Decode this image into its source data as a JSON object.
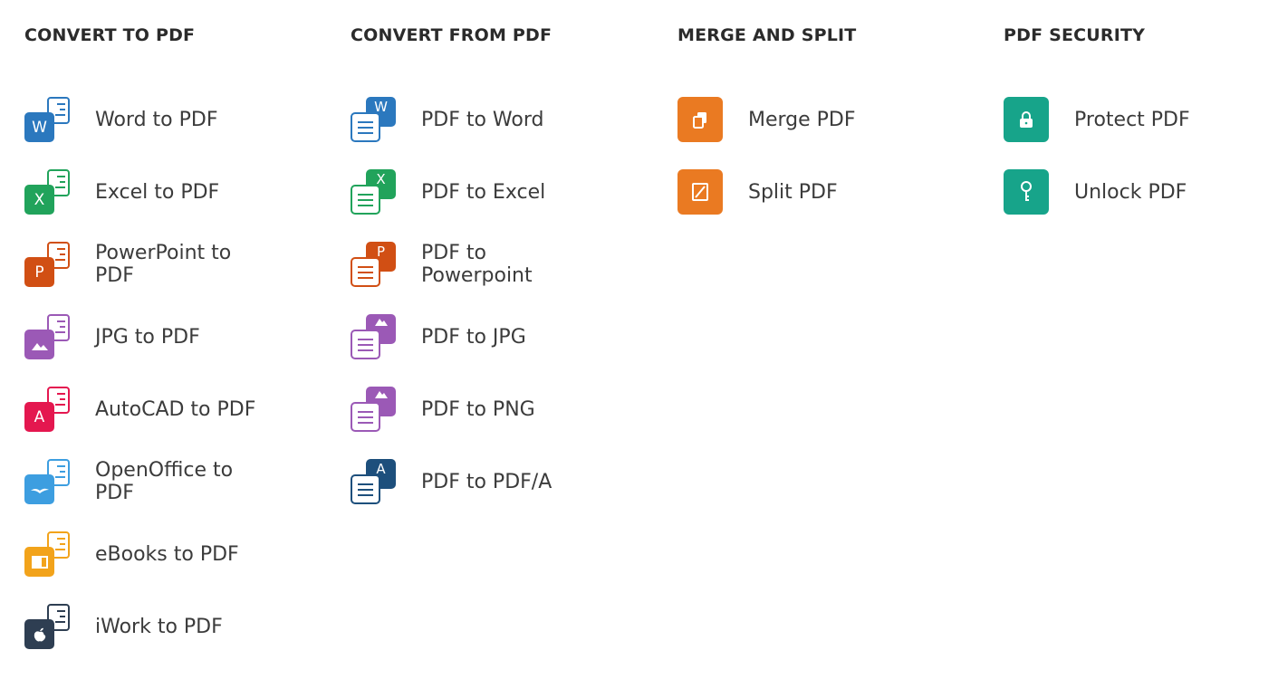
{
  "colors": {
    "word": "#2b78be",
    "excel": "#21a35b",
    "powerpoint": "#d14f14",
    "image": "#9b59b6",
    "autocad": "#e4174f",
    "openoffice": "#3d9ee0",
    "ebooks": "#f2a31b",
    "iwork": "#2e3e52",
    "pdfa": "#1d4f7c",
    "merge": "#ea7a22",
    "security": "#17a48a"
  },
  "columns": [
    {
      "title": "CONVERT TO PDF",
      "items": [
        {
          "label": "Word to PDF",
          "icon": "word-to-pdf-icon",
          "glyph": "W"
        },
        {
          "label": "Excel to PDF",
          "icon": "excel-to-pdf-icon",
          "glyph": "X"
        },
        {
          "label": "PowerPoint to PDF",
          "icon": "powerpoint-to-pdf-icon",
          "glyph": "P"
        },
        {
          "label": "JPG to PDF",
          "icon": "jpg-to-pdf-icon",
          "glyph": "image"
        },
        {
          "label": "AutoCAD to PDF",
          "icon": "autocad-to-pdf-icon",
          "glyph": "A"
        },
        {
          "label": "OpenOffice to PDF",
          "icon": "openoffice-to-pdf-icon",
          "glyph": "gull"
        },
        {
          "label": "eBooks to PDF",
          "icon": "ebooks-to-pdf-icon",
          "glyph": "book"
        },
        {
          "label": "iWork to PDF",
          "icon": "iwork-to-pdf-icon",
          "glyph": "apple"
        }
      ]
    },
    {
      "title": "CONVERT FROM PDF",
      "items": [
        {
          "label": "PDF to Word",
          "icon": "pdf-to-word-icon",
          "glyph": "W"
        },
        {
          "label": "PDF to Excel",
          "icon": "pdf-to-excel-icon",
          "glyph": "X"
        },
        {
          "label": "PDF to Powerpoint",
          "icon": "pdf-to-powerpoint-icon",
          "glyph": "P"
        },
        {
          "label": "PDF to JPG",
          "icon": "pdf-to-jpg-icon",
          "glyph": "image"
        },
        {
          "label": "PDF to PNG",
          "icon": "pdf-to-png-icon",
          "glyph": "image"
        },
        {
          "label": "PDF to PDF/A",
          "icon": "pdf-to-pdfa-icon",
          "glyph": "A"
        }
      ]
    },
    {
      "title": "MERGE AND SPLIT",
      "items": [
        {
          "label": "Merge PDF",
          "icon": "merge-pdf-icon"
        },
        {
          "label": "Split PDF",
          "icon": "split-pdf-icon"
        }
      ]
    },
    {
      "title": "PDF SECURITY",
      "items": [
        {
          "label": "Protect PDF",
          "icon": "lock-icon"
        },
        {
          "label": "Unlock PDF",
          "icon": "key-icon"
        }
      ]
    }
  ]
}
